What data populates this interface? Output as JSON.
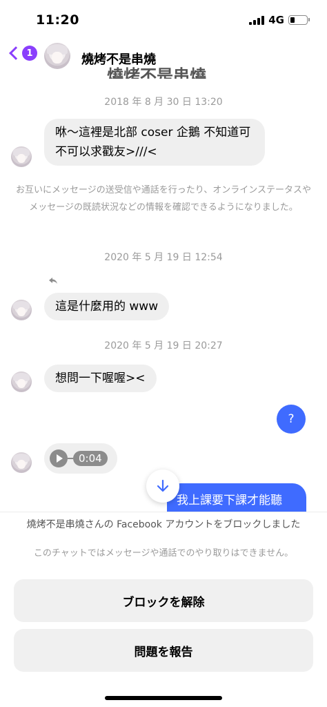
{
  "status_bar": {
    "time": "11:20",
    "network": "4G"
  },
  "header": {
    "back_badge": "1",
    "contact_name": "燒烤不是串燒",
    "ghost_title": "燒烤不是串燒"
  },
  "thread": {
    "timestamp_1": "2018 年 8 月 30 日 13:20",
    "message_1": "咻～這裡是北部 coser 企鵝 不知道可不可以求戳友>///<",
    "system_notice": "お互いにメッセージの送受信や通話を行ったり、オンラインステータスやメッセージの既読状況などの情報を確認できるようになりました。",
    "timestamp_2": "2020 年 5 月 19 日 12:54",
    "message_2": "這是什麼用的 www",
    "timestamp_3": "2020 年 5 月 19 日 20:27",
    "message_3": "想問一下喔喔><",
    "outgoing_1": "?",
    "audio_duration": "0:04",
    "outgoing_2": "我上課要下課才能聽"
  },
  "blocked_panel": {
    "title": "燒烤不是串燒さんの Facebook アカウントをブロックしました",
    "subtitle": "このチャットではメッセージや通話でのやり取りはできません。",
    "unblock_label": "ブロックを解除",
    "report_label": "問題を報告"
  },
  "colors": {
    "accent_purple": "#8a3ffc",
    "outgoing_blue": "#3f6bff",
    "bubble_gray": "#efefef"
  }
}
